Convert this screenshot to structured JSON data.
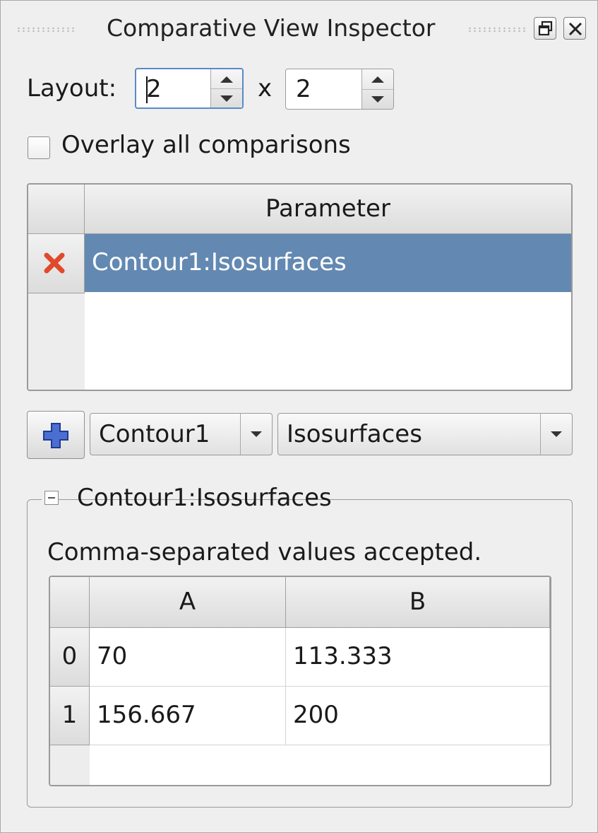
{
  "window": {
    "title": "Comparative View Inspector"
  },
  "layout": {
    "label": "Layout:",
    "rows_value": "2",
    "separator": "x",
    "cols_value": "2"
  },
  "overlay": {
    "label": "Overlay all comparisons",
    "checked": false
  },
  "parameter_table": {
    "header": "Parameter",
    "rows": [
      {
        "label": "Contour1:Isosurfaces",
        "selected": true,
        "remove_icon": "red-x-icon"
      }
    ],
    "selection_color": "#6389b2"
  },
  "add_row": {
    "add_icon": "blue-plus-icon",
    "source_combo": "Contour1",
    "property_combo": "Isosurfaces"
  },
  "group": {
    "title": "Contour1:Isosurfaces",
    "hint": "Comma-separated values accepted.",
    "columns": [
      "A",
      "B"
    ],
    "rows": [
      {
        "index": "0",
        "A": "70",
        "B": "113.333"
      },
      {
        "index": "1",
        "A": "156.667",
        "B": "200"
      }
    ]
  }
}
